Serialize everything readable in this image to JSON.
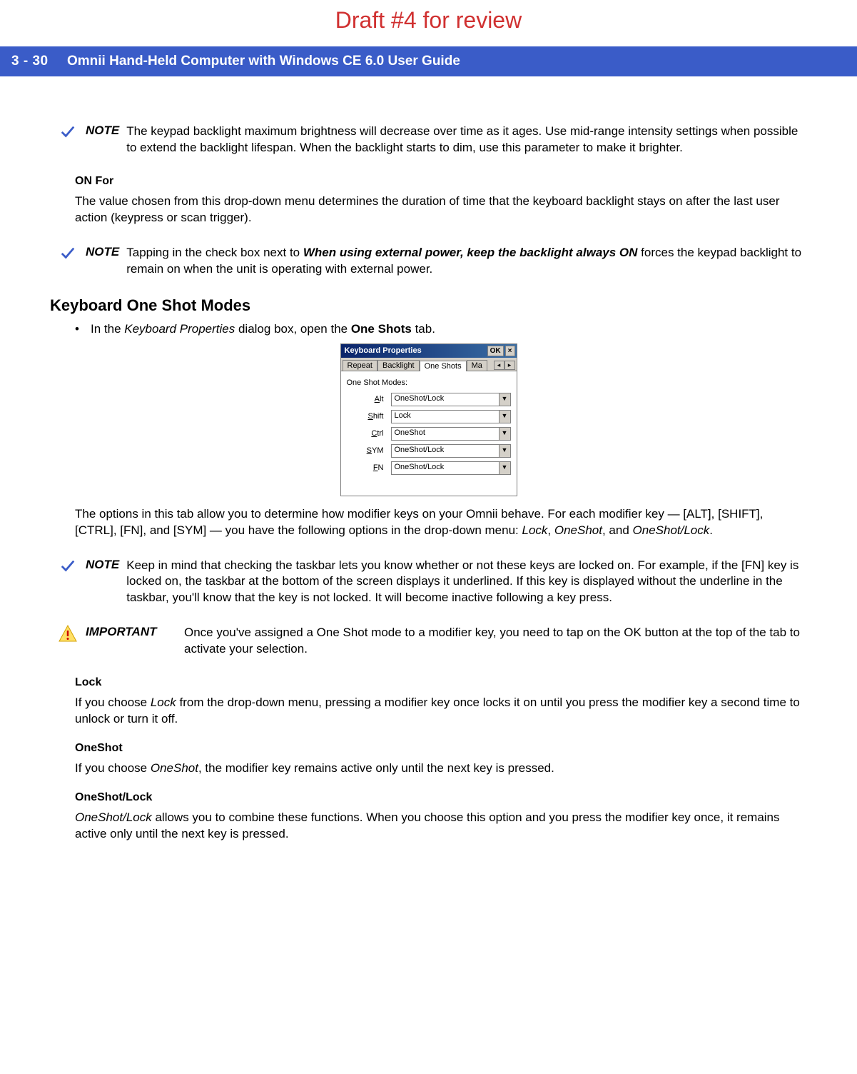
{
  "draft_banner": "Draft #4 for review",
  "header": {
    "page_number": "3 - 30",
    "title": "Omnii Hand-Held Computer with Windows CE 6.0 User Guide"
  },
  "note1": {
    "label": "NOTE",
    "text": "The keypad backlight maximum brightness will decrease over time as it ages. Use mid-range intensity settings when possible to extend the backlight lifespan. When the backlight starts to dim, use this parameter to make it brighter."
  },
  "on_for": {
    "heading": "ON For",
    "text": "The value chosen from this drop-down menu determines the duration of time that the keyboard backlight stays on after the last user action (keypress or scan trigger)."
  },
  "note2": {
    "label": "NOTE",
    "text_before": "Tapping in the check box next to ",
    "emphasis": "When using external power, keep the backlight always ON",
    "text_after": " forces the keypad backlight to remain on when the unit is operating with external power."
  },
  "section": {
    "heading": "Keyboard One Shot Modes",
    "bullet_prefix": "In the ",
    "bullet_italic": "Keyboard Properties",
    "bullet_mid": " dialog box, open the ",
    "bullet_bold": "One Shots",
    "bullet_suffix": " tab."
  },
  "dialog": {
    "title": "Keyboard Properties",
    "ok": "OK",
    "close": "×",
    "tabs": {
      "repeat": "Repeat",
      "backlight": "Backlight",
      "one_shots": "One Shots",
      "ma": "Ma"
    },
    "arrow_left": "◂",
    "arrow_right": "▸",
    "group_label": "One Shot Modes:",
    "rows": [
      {
        "key": "A",
        "rest": "lt",
        "value": "OneShot/Lock"
      },
      {
        "key": "S",
        "rest": "hift",
        "value": "Lock"
      },
      {
        "key": "C",
        "rest": "trl",
        "value": "OneShot"
      },
      {
        "key": "S",
        "rest": "YM",
        "value": "OneShot/Lock"
      },
      {
        "key": "F",
        "rest": "N",
        "value": "OneShot/Lock"
      }
    ]
  },
  "options_text": {
    "pre": "The options in this tab allow you to determine how modifier keys on your Omnii behave. For each modifier key — [ALT], [SHIFT], [CTRL], [FN], and [SYM] — you have the following options in the drop-down menu: ",
    "i1": "Lock",
    "sep1": ", ",
    "i2": "OneShot",
    "sep2": ", and ",
    "i3": "OneShot/Lock",
    "suffix": "."
  },
  "note3": {
    "label": "NOTE",
    "text": "Keep in mind that checking the taskbar lets you know whether or not these keys are locked on. For example, if the [FN] key is locked on, the taskbar at the bottom of the screen displays it underlined. If this key is displayed without the underline in the taskbar, you'll know that the key is not locked. It will become inactive following a key press."
  },
  "important": {
    "label": "IMPORTANT",
    "text": "Once you've assigned a One Shot mode to a modifier key, you need to tap on the OK button at the top of the tab to activate your selection."
  },
  "lock": {
    "heading": "Lock",
    "pre": "If you choose ",
    "i": "Lock",
    "post": " from the drop-down menu, pressing a modifier key once locks it on until you press the modifier key a second time to unlock or turn it off."
  },
  "oneshot": {
    "heading": "OneShot",
    "pre": "If you choose ",
    "i": "OneShot",
    "post": ", the modifier key remains active only until the next key is pressed."
  },
  "oneshotlock": {
    "heading": "OneShot/Lock",
    "i": "OneShot/Lock",
    "post": " allows you to combine these functions. When you choose this option and you press the modifier key once, it remains active only until the next key is pressed."
  }
}
